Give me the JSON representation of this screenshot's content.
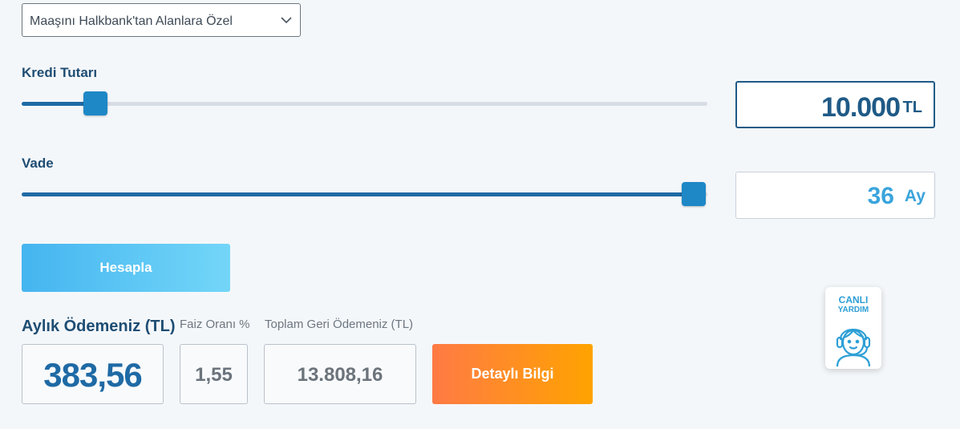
{
  "loan_type": {
    "selected": "Maaşını Halkbank'tan Alanlara Özel"
  },
  "amount": {
    "label": "Kredi Tutarı",
    "value": "10.000",
    "unit": "TL",
    "slider_position": 0.108
  },
  "term": {
    "label": "Vade",
    "value": "36",
    "unit": "Ay",
    "slider_position": 0.98
  },
  "actions": {
    "calculate_label": "Hesapla",
    "details_label": "Detaylı Bilgi"
  },
  "results": {
    "monthly_title": "Aylık Ödemeniz (TL)",
    "monthly_value": "383,56",
    "rate_title": "Faiz Oranı %",
    "rate_value": "1,55",
    "total_title": "Toplam Geri Ödemeniz (TL)",
    "total_value": "13.808,16"
  },
  "live_help": {
    "line1": "CANLI",
    "line2": "YARDIM",
    "icon": "support-agent-icon"
  },
  "colors": {
    "primary": "#1f6aa5",
    "accent": "#3aa4dc",
    "calculate_gradient": [
      "#45b5f0",
      "#73d6f8"
    ],
    "details_gradient": [
      "#ff7a45",
      "#ffa300"
    ]
  }
}
